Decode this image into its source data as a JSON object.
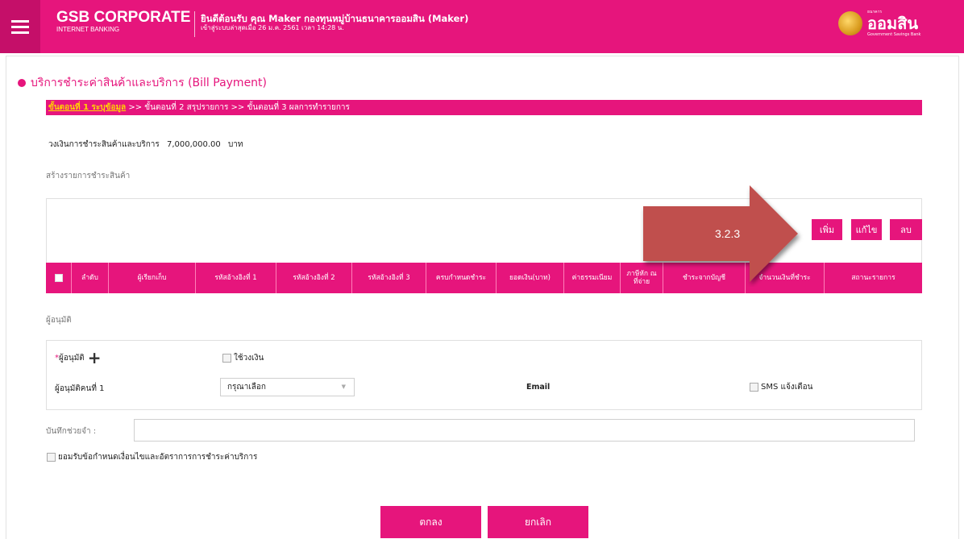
{
  "header": {
    "brand": "GSB CORPORATE",
    "brand_sub": "INTERNET BANKING",
    "welcome": "ยินดีต้อนรับ คุณ Maker กองทุนหมู่บ้านธนาคารออมสิน (Maker)",
    "last_login": "เข้าสู่ระบบล่าสุดเมื่อ 26 ม.ค. 2561 เวลา 14:28 น.",
    "logo_text": "ออมสิน",
    "logo_top": "ธนาคาร",
    "logo_sub": "Government Savings Bank"
  },
  "page": {
    "title": "บริการชำระค่าสินค้าและบริการ (Bill Payment)"
  },
  "steps": {
    "step1": "ขั้นตอนที่ 1 ระบุข้อมูล",
    "sep1": " >> ",
    "step2": "ขั้นตอนที่ 2 สรุปรายการ",
    "sep2": " >> ",
    "step3": "ขั้นตอนที่ 3 ผลการทำรายการ"
  },
  "limit": {
    "label": "วงเงินการชำระสินค้าและบริการ",
    "amount": "7,000,000.00",
    "unit": "บาท"
  },
  "create_section": "สร้างรายการชำระสินค้า",
  "actions": {
    "add": "เพิ่ม",
    "edit": "แก้ไข",
    "delete": "ลบ"
  },
  "callout": "3.2.3",
  "table": {
    "headers": [
      "ลำดับ",
      "ผู้เรียกเก็บ",
      "รหัสอ้างอิงที่ 1",
      "รหัสอ้างอิงที่ 2",
      "รหัสอ้างอิงที่ 3",
      "ครบกำหนดชำระ",
      "ยอดเงิน(บาท)",
      "ค่าธรรมเนียม",
      "ภาษีหัก ณ ที่จ่าย",
      "ชำระจากบัญชี",
      "จำนวนเงินที่ชำระ",
      "สถานะรายการ"
    ]
  },
  "approver_section": "ผู้อนุมัติ",
  "approver": {
    "required_mark": "*",
    "label": "ผู้อนุมัติ",
    "use_limit": "ใช้วงเงิน",
    "approver1": "ผู้อนุมัติคนที่ 1",
    "select_value": "กรุณาเลือก",
    "email": "Email",
    "sms": "SMS แจ้งเตือน"
  },
  "memo_label": "บันทึกช่วยจำ :",
  "terms": "ยอมรับข้อกำหนดเงื่อนไขและอัตราการการชำระค่าบริการ",
  "buttons": {
    "ok": "ตกลง",
    "cancel": "ยกเลิก"
  },
  "colors": {
    "brand": "#e6157c",
    "callout": "#c0504d"
  }
}
